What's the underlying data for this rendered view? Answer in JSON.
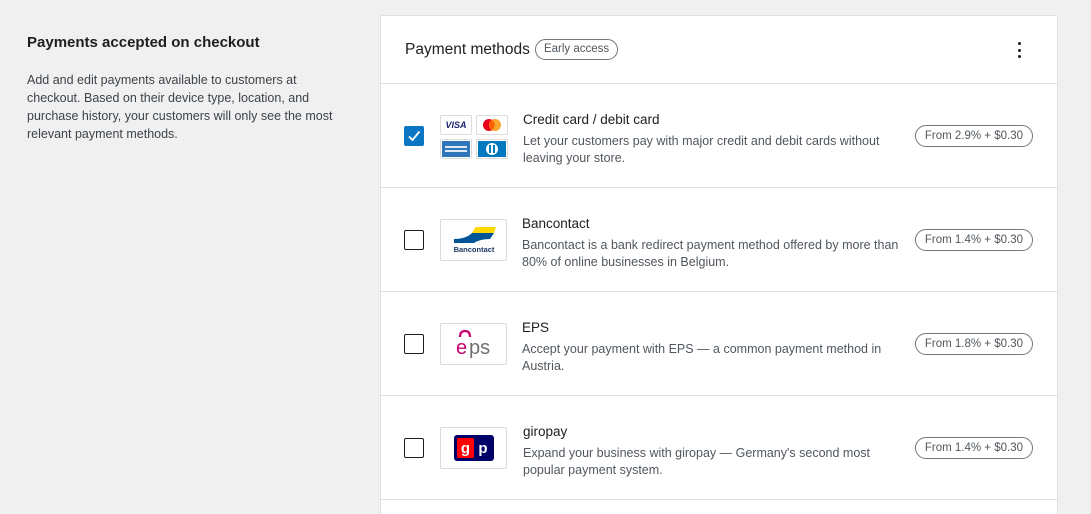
{
  "section": {
    "title": "Payments accepted on checkout",
    "description": "Add and edit payments available to customers at checkout. Based on their device type, location, and purchase history, your customers will only see the most relevant payment methods."
  },
  "card": {
    "title": "Payment methods",
    "badge": "Early access"
  },
  "methods": [
    {
      "name": "Credit card / debit card",
      "description": "Let your customers pay with major credit and debit cards without leaving your store.",
      "fee": "From 2.9% + $0.30",
      "checked": true,
      "icons": [
        "visa-icon",
        "mastercard-icon",
        "amex-icon",
        "diners-icon"
      ],
      "visa_text": "VISA"
    },
    {
      "name": "Bancontact",
      "description": "Bancontact is a bank redirect payment method offered by more than 80% of online businesses in Belgium.",
      "fee": "From 1.4% + $0.30",
      "checked": false,
      "logo_text": "Bancontact"
    },
    {
      "name": "EPS",
      "description": "Accept your payment with EPS — a common payment method in Austria.",
      "fee": "From 1.8% + $0.30",
      "checked": false,
      "logo_text": "eps"
    },
    {
      "name": "giropay",
      "description": "Expand your business with giropay — Germany's second most popular payment system.",
      "fee": "From 1.4% + $0.30",
      "checked": false,
      "logo_text": "gp"
    }
  ],
  "colors": {
    "accent": "#0a75c2",
    "background": "#f0f0f1",
    "eps_pink": "#c8036f",
    "giropay_navy": "#000268",
    "giropay_red": "#ff0007",
    "bancontact_blue": "#005498",
    "bancontact_yellow": "#ffd800"
  }
}
